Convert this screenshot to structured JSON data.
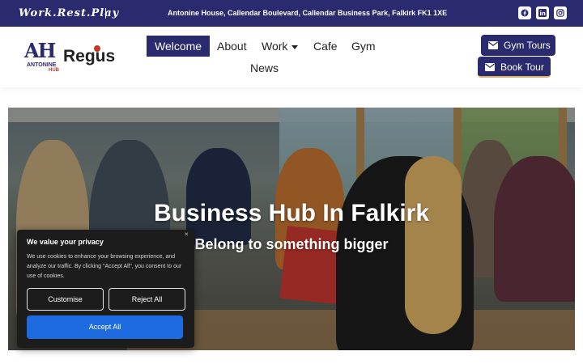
{
  "topbar": {
    "tagline": "Work.Rest.Play",
    "address": "Antonine House, Callendar Boulevard, Callendar Business Park, Falkirk FK1 1XE",
    "social": [
      "facebook-icon",
      "linkedin-icon",
      "instagram-icon"
    ],
    "background": "#2a2a6e"
  },
  "logo": {
    "mark": "AH",
    "line1": "ANTONINE",
    "line2": "HUB",
    "brand": "Regus"
  },
  "nav": {
    "items": [
      {
        "label": "Welcome",
        "active": true
      },
      {
        "label": "About"
      },
      {
        "label": "Work",
        "has_dropdown": true
      },
      {
        "label": "Cafe"
      },
      {
        "label": "Gym"
      },
      {
        "label": "News"
      }
    ]
  },
  "cta": {
    "gym_tours": "Gym Tours",
    "book_tour": "Book Tour",
    "icon": "envelope-icon"
  },
  "hero": {
    "title": "Business Hub In Falkirk",
    "subtitle": "Belong to something bigger"
  },
  "cookie": {
    "title": "We value your privacy",
    "text": "We use cookies to enhance your browsing experience, and analyze our traffic. By clicking \"Accept All\", you consent to our use of cookies.",
    "customise": "Customise",
    "reject": "Reject All",
    "accept": "Accept All",
    "close": "×",
    "accent": "#1e6be0"
  }
}
